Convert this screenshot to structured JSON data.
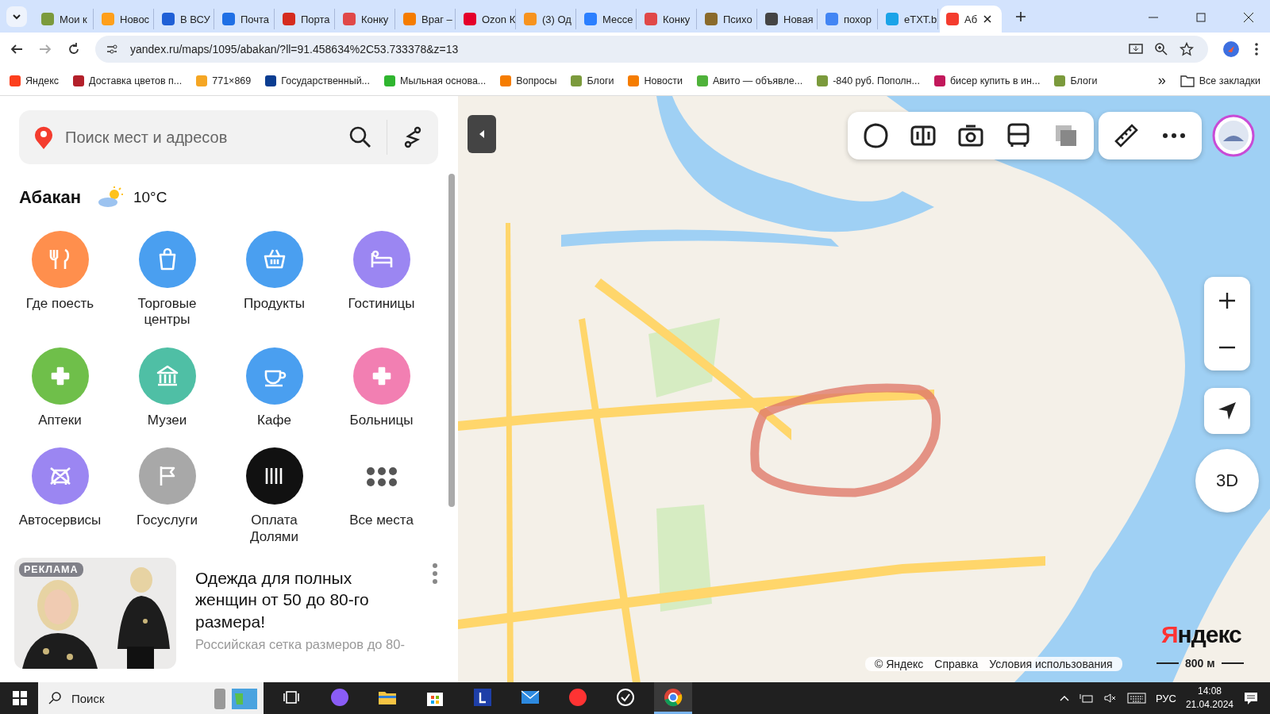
{
  "browser": {
    "tabs": [
      {
        "label": "Мои к",
        "selected": false,
        "color": "#7b9a3c"
      },
      {
        "label": "Новос",
        "selected": false,
        "color": "#ff9f1a"
      },
      {
        "label": "В ВСУ",
        "selected": false,
        "color": "#1f5fd6"
      },
      {
        "label": "Почта",
        "selected": false,
        "color": "#1f6fe5"
      },
      {
        "label": "Порта",
        "selected": false,
        "color": "#d52b1e"
      },
      {
        "label": "Конку",
        "selected": false,
        "color": "#e04848"
      },
      {
        "label": "Враг –",
        "selected": false,
        "color": "#f57c00"
      },
      {
        "label": "Ozon К",
        "selected": false,
        "color": "#e4002b"
      },
      {
        "label": "(3) Од",
        "selected": false,
        "color": "#f7931e"
      },
      {
        "label": "Мессе",
        "selected": false,
        "color": "#2b7fff"
      },
      {
        "label": "Конку",
        "selected": false,
        "color": "#e04848"
      },
      {
        "label": "Психо",
        "selected": false,
        "color": "#8a6a2a"
      },
      {
        "label": "Новая",
        "selected": false,
        "color": "#444444"
      },
      {
        "label": "похор",
        "selected": false,
        "color": "#4285f4"
      },
      {
        "label": "eTXT.b",
        "selected": false,
        "color": "#1aa3e8"
      },
      {
        "label": "Аб",
        "selected": true,
        "color": "#f43c2e"
      }
    ],
    "address": "yandex.ru/maps/1095/abakan/?ll=91.458634%2C53.733378&z=13",
    "bookmarks": [
      {
        "label": "Яндекс",
        "color": "#fc3f1d"
      },
      {
        "label": "Доставка цветов п...",
        "color": "#b3202a"
      },
      {
        "label": "771×869",
        "color": "#f5a623"
      },
      {
        "label": "Государственный...",
        "color": "#0b3d91"
      },
      {
        "label": "Мыльная основа...",
        "color": "#2fb52f"
      },
      {
        "label": "Вопросы",
        "color": "#f57c00"
      },
      {
        "label": "Блоги",
        "color": "#7b9a3c"
      },
      {
        "label": "Новости",
        "color": "#f57c00"
      },
      {
        "label": "Авито — объявле...",
        "color": "#4fb23a"
      },
      {
        "label": "-840 руб. Пополн...",
        "color": "#7b9a3c"
      },
      {
        "label": "бисер купить в ин...",
        "color": "#c2185b"
      },
      {
        "label": "Блоги",
        "color": "#7b9a3c"
      }
    ],
    "bookmarks_more": "»",
    "all_bookmarks": "Все закладки"
  },
  "sidebar": {
    "search": {
      "placeholder": "Поиск мест и адресов"
    },
    "city": "Абакан",
    "temperature": "10°C",
    "categories": [
      {
        "label": "Где поесть",
        "color": "#ff8f4d"
      },
      {
        "label": "Торговые центры",
        "color": "#4a9ff0"
      },
      {
        "label": "Продукты",
        "color": "#4a9ff0"
      },
      {
        "label": "Гостиницы",
        "color": "#9b86f2"
      },
      {
        "label": "Аптеки",
        "color": "#6fbf4a"
      },
      {
        "label": "Музеи",
        "color": "#4fbfa5"
      },
      {
        "label": "Кафе",
        "color": "#4a9ff0"
      },
      {
        "label": "Больницы",
        "color": "#f27fb2"
      },
      {
        "label": "Автосервисы",
        "color": "#9b86f2"
      },
      {
        "label": "Госуслуги",
        "color": "#a8a8a8"
      },
      {
        "label": "Оплата Долями",
        "color": "#111111"
      },
      {
        "label": "Все места"
      }
    ],
    "ad": {
      "badge": "РЕКЛАМА",
      "title": "Одежда для полных женщин от 50 до 80-го размера!",
      "text": "Российская сетка размеров до 80-"
    }
  },
  "map": {
    "logo": "Яндекс",
    "view_3d": "3D",
    "footer": [
      "© Яндекс",
      "Справка",
      "Условия использования"
    ],
    "scale": "800 м"
  },
  "taskbar": {
    "search": {
      "placeholder": "Поиск"
    },
    "apps": [
      {
        "kind": "task-view",
        "active": false
      },
      {
        "kind": "alice",
        "active": false
      },
      {
        "kind": "folder",
        "active": false
      },
      {
        "kind": "store",
        "active": false
      },
      {
        "kind": "letter",
        "active": false
      },
      {
        "kind": "mail",
        "active": false
      },
      {
        "kind": "yandex",
        "active": false
      },
      {
        "kind": "clock",
        "active": false
      },
      {
        "kind": "chrome",
        "active": true
      }
    ],
    "language": "РУС",
    "time": "14:08",
    "date": "21.04.2024"
  }
}
